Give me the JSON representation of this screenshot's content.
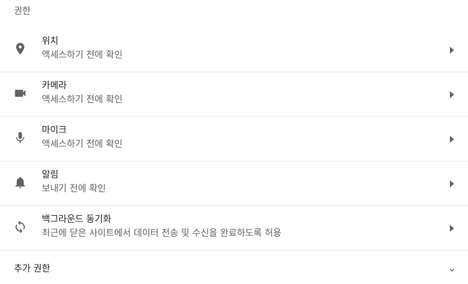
{
  "section": {
    "title": "권한"
  },
  "permissions": [
    {
      "icon": "location-pin-icon",
      "label": "위치",
      "sub": "액세스하기 전에 확인"
    },
    {
      "icon": "videocam-icon",
      "label": "카메라",
      "sub": "액세스하기 전에 확인"
    },
    {
      "icon": "microphone-icon",
      "label": "마이크",
      "sub": "액세스하기 전에 확인"
    },
    {
      "icon": "bell-icon",
      "label": "알림",
      "sub": "보내기 전에 확인"
    },
    {
      "icon": "sync-icon",
      "label": "백그라운드 동기화",
      "sub": "최근에 닫은 사이트에서 데이터 전송 및 수신을 완료하도록 허용"
    }
  ],
  "more": {
    "label": "추가 권한",
    "icon": "chevron-down-icon"
  },
  "colors": {
    "icon": "#5f6368",
    "text": "#202124",
    "subtext": "#5f6368",
    "divider": "#e8eaed"
  }
}
